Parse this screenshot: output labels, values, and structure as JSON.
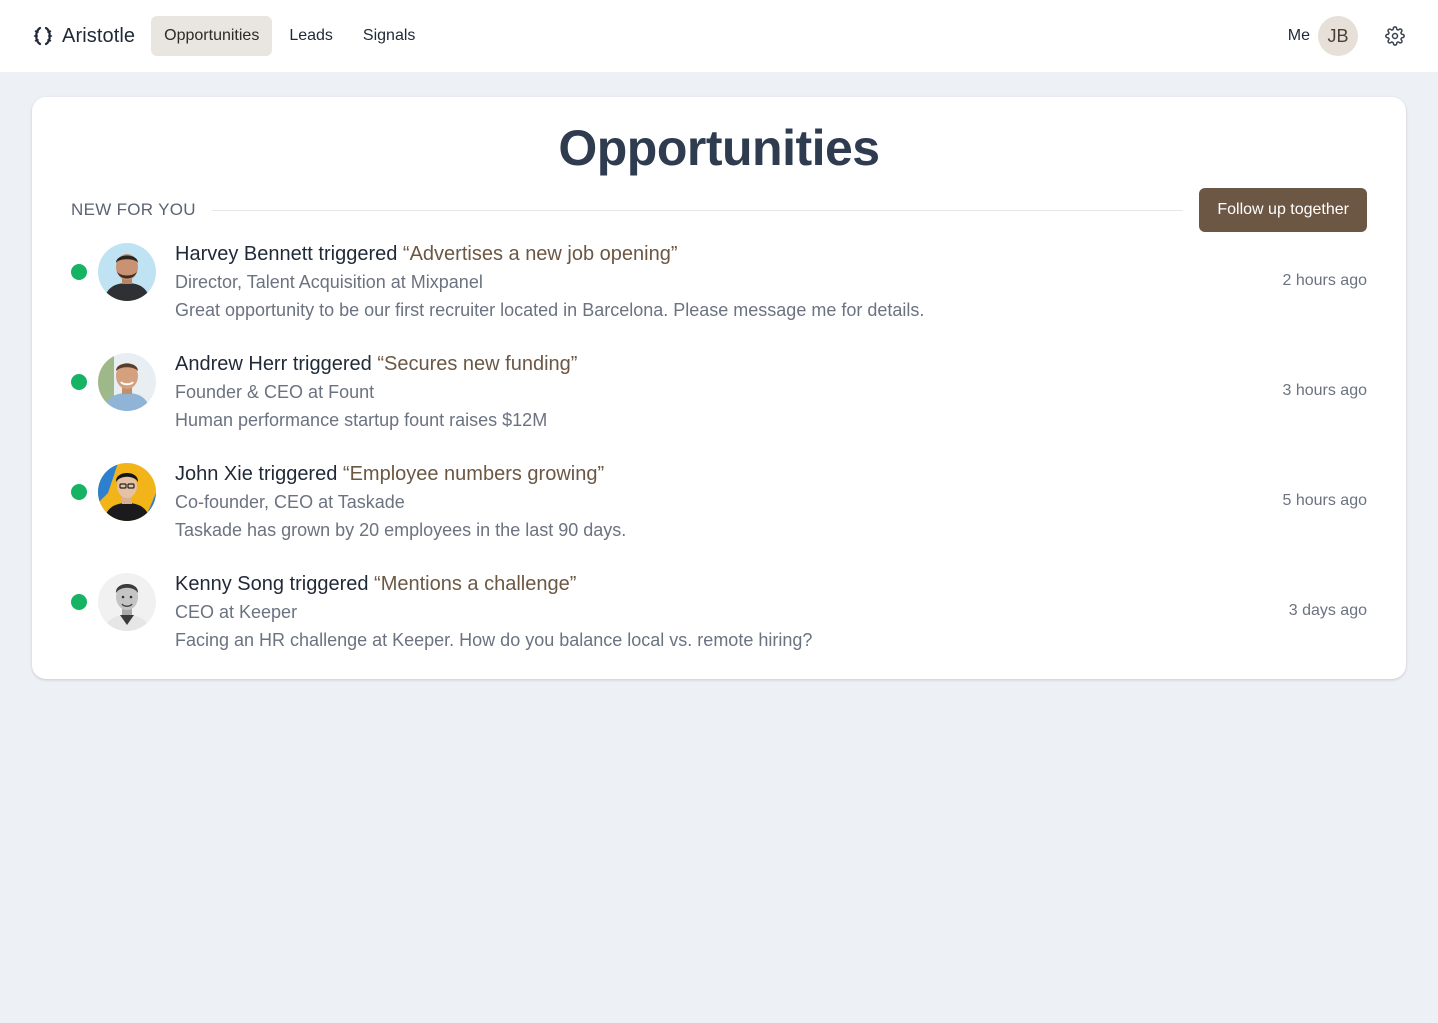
{
  "app": {
    "name": "Aristotle",
    "logo_icon": "laurel-icon"
  },
  "nav": {
    "items": [
      {
        "label": "Opportunities",
        "active": true
      },
      {
        "label": "Leads",
        "active": false
      },
      {
        "label": "Signals",
        "active": false
      }
    ]
  },
  "user": {
    "me_label": "Me",
    "initials": "JB",
    "settings_icon": "gear-icon"
  },
  "page": {
    "title": "Opportunities",
    "section_label": "NEW FOR YOU",
    "follow_button": "Follow up together"
  },
  "colors": {
    "accent": "#6b5744",
    "status_new": "#16b364",
    "title": "#2f3b4e"
  },
  "opportunities": [
    {
      "name": "Harvey Bennett",
      "verb": "triggered",
      "signal": "“Advertises a new job opening”",
      "role": "Director, Talent Acquisition at Mixpanel",
      "message": "Great opportunity to be our first recruiter located in Barcelona. Please message me for details.",
      "time": "2 hours ago"
    },
    {
      "name": "Andrew Herr",
      "verb": "triggered",
      "signal": "“Secures new funding”",
      "role": "Founder & CEO at Fount",
      "message": "Human performance startup fount raises $12M",
      "time": "3 hours ago"
    },
    {
      "name": "John Xie",
      "verb": "triggered",
      "signal": "“Employee numbers growing”",
      "role": "Co-founder, CEO at Taskade",
      "message": "Taskade has grown by 20 employees in the last 90 days.",
      "time": "5 hours ago"
    },
    {
      "name": "Kenny Song",
      "verb": "triggered",
      "signal": "“Mentions a challenge”",
      "role": "CEO at Keeper",
      "message": "Facing an HR challenge at Keeper. How do you balance local vs. remote hiring?",
      "time": "3 days ago"
    }
  ]
}
